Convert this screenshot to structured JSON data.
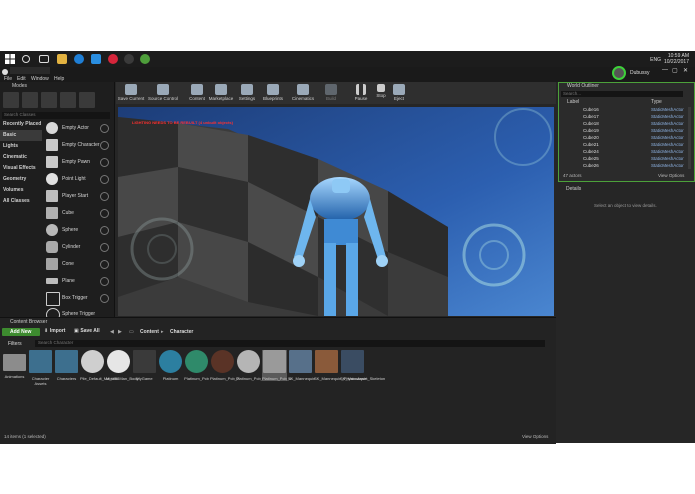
{
  "taskbar": {
    "tray": {
      "lang": "ENG",
      "time": "10:59 AM",
      "date": "10/22/2017"
    }
  },
  "app": {
    "user": "Dubussy",
    "menu": [
      "File",
      "Edit",
      "Window",
      "Help"
    ],
    "modes_tab": "Modes",
    "search_placeholder": "Search Classes",
    "categories": [
      "Recently Placed",
      "Basic",
      "Lights",
      "Cinematic",
      "Visual Effects",
      "Geometry",
      "Volumes",
      "All Classes"
    ],
    "place_items": [
      "Empty Actor",
      "Empty Character",
      "Empty Pawn",
      "Point Light",
      "Player Start",
      "Cube",
      "Sphere",
      "Cylinder",
      "Cone",
      "Plane",
      "Box Trigger",
      "Sphere Trigger"
    ],
    "toolbar": [
      "Save Current",
      "Source Control",
      "Content",
      "Marketplace",
      "Settings",
      "Blueprints",
      "Cinematics",
      "Build",
      "Pause",
      "Stop",
      "Eject"
    ],
    "viewport_warning": "LIGHTING NEEDS TO BE REBUILT (4 unbuilt objects)",
    "content_browser": {
      "tab": "Content Browser",
      "add_new": "Add New",
      "import": "Import",
      "save_all": "Save All",
      "path": [
        "Content",
        "Character"
      ],
      "filters": "Filters",
      "search_placeholder": "Search Character",
      "assets": [
        "Animations",
        "Character Assets",
        "Characters",
        "Pile_Default_Material",
        "M_UE4Man_Body",
        "MyGame",
        "Platinum",
        "Platinum_Pcb",
        "Platinum_Pcb_2",
        "Platinum_Pcb_3",
        "Platinum_Pcb_4",
        "SK_Mannequin",
        "SK_Mannequin_PhysicsAsset",
        "SK_Mannequin_Skeleton"
      ],
      "count": "14 items (1 selected)",
      "view_options": "View Options"
    },
    "outliner": {
      "tab": "World Outliner",
      "search_placeholder": "Search...",
      "col_label": "Label",
      "col_type": "Type",
      "rows": [
        {
          "label": "Cube16",
          "type": "StaticMeshActor"
        },
        {
          "label": "Cube17",
          "type": "StaticMeshActor"
        },
        {
          "label": "Cube18",
          "type": "StaticMeshActor"
        },
        {
          "label": "Cube19",
          "type": "StaticMeshActor"
        },
        {
          "label": "Cube20",
          "type": "StaticMeshActor"
        },
        {
          "label": "Cube21",
          "type": "StaticMeshActor"
        },
        {
          "label": "Cube24",
          "type": "StaticMeshActor"
        },
        {
          "label": "Cube25",
          "type": "StaticMeshActor"
        },
        {
          "label": "Cube26",
          "type": "StaticMeshActor"
        }
      ],
      "actor_count": "47 actors",
      "view_options": "View Options"
    },
    "details": {
      "tab": "Details",
      "placeholder": "Select an object to view details."
    }
  }
}
